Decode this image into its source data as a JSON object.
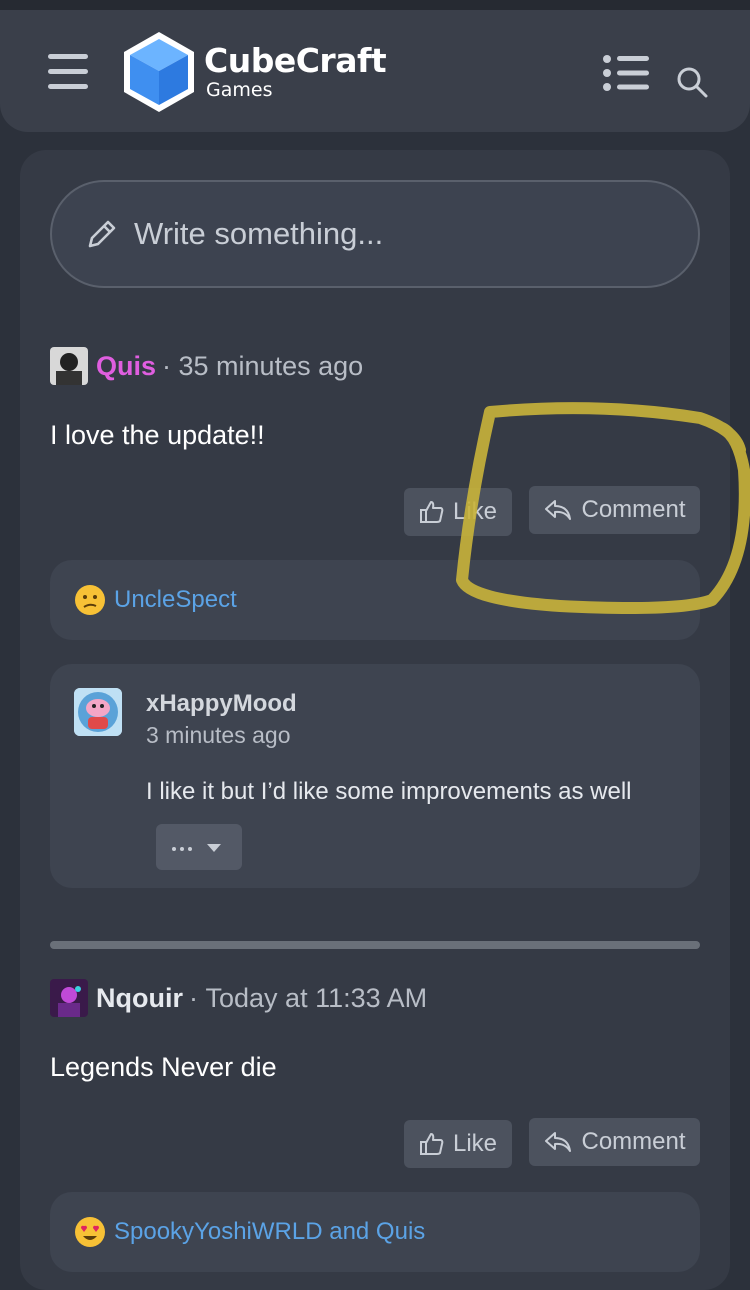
{
  "header": {
    "brand_name": "CubeCraft",
    "brand_sub": "Games",
    "menu_icon": "hamburger-icon",
    "list_icon": "list-icon",
    "search_icon": "search-icon"
  },
  "composer": {
    "placeholder": "Write something..."
  },
  "posts": [
    {
      "author": "Quis",
      "author_color": "#e05ee0",
      "time": "35 minutes ago",
      "text": "I love the update!!",
      "like_label": "Like",
      "comment_label": "Comment",
      "reaction_emoji": "confused-face",
      "reactions": "UncleSpect",
      "reply": {
        "author": "xHappyMood",
        "time": "3 minutes ago",
        "text": "I like it but I’d like some improvements as well"
      }
    },
    {
      "author": "Nqouir",
      "author_color": "#e6e9ee",
      "time": "Today at 11:33 AM",
      "text": "Legends Never die",
      "like_label": "Like",
      "comment_label": "Comment",
      "reaction_emoji": "heart-eyes-face",
      "reactions": "SpookyYoshiWRLD and Quis"
    }
  ],
  "colors": {
    "background": "#2c313b",
    "card": "#353a45",
    "link": "#5ba3e6",
    "highlight": "#c9b43a"
  }
}
